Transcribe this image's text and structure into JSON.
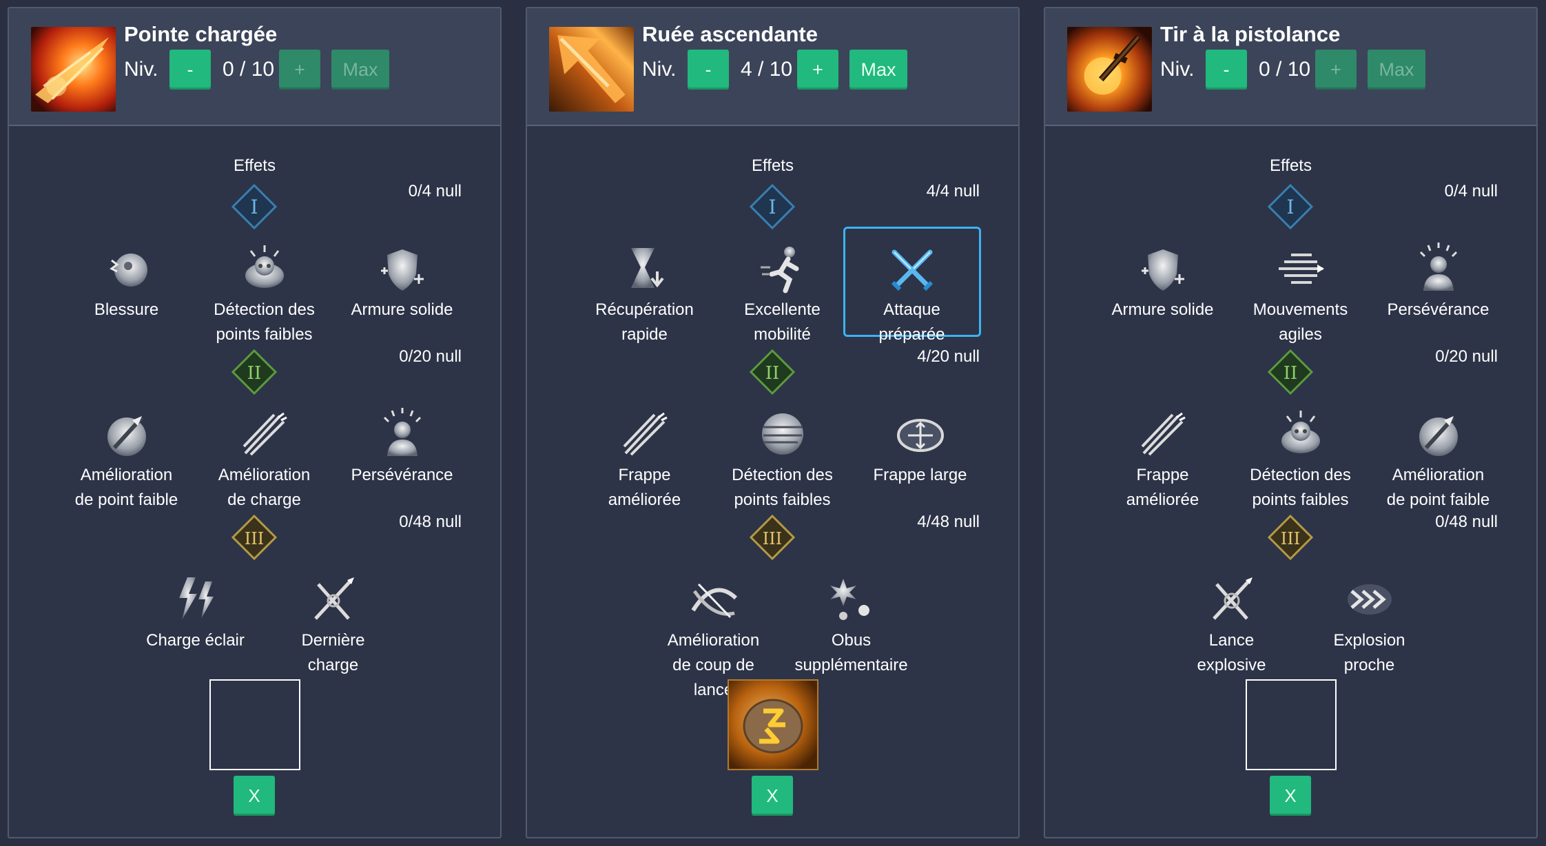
{
  "panels": [
    {
      "name": "Pointe chargée",
      "level_label": "Niv.",
      "level": "0 / 10",
      "minus": "-",
      "plus": "+",
      "max": "Max",
      "effects_title": "Effets",
      "tiers": [
        {
          "numeral": "I",
          "count": "0/4 null",
          "tripods": [
            {
              "label": "Blessure",
              "icon": "wound-icon"
            },
            {
              "label": "Détection des points faibles",
              "icon": "weak-point-detection-icon"
            },
            {
              "label": "Armure solide",
              "icon": "solid-armor-icon"
            }
          ]
        },
        {
          "numeral": "II",
          "count": "0/20 null",
          "tripods": [
            {
              "label": "Amélioration de point faible",
              "icon": "weak-point-enhancement-icon"
            },
            {
              "label": "Amélioration de charge",
              "icon": "charge-enhancement-icon"
            },
            {
              "label": "Persévérance",
              "icon": "perseverance-icon"
            }
          ]
        },
        {
          "numeral": "III",
          "count": "0/48 null",
          "tripods": [
            {
              "label": "Charge éclair",
              "icon": "lightning-charge-icon"
            },
            {
              "label": "Dernière charge",
              "icon": "last-charge-icon"
            }
          ]
        }
      ],
      "rune": "empty",
      "close": "X"
    },
    {
      "name": "Ruée ascendante",
      "level_label": "Niv.",
      "level": "4 / 10",
      "minus": "-",
      "plus": "+",
      "max": "Max",
      "effects_title": "Effets",
      "tiers": [
        {
          "numeral": "I",
          "count": "4/4 null",
          "tripods": [
            {
              "label": "Récupération rapide",
              "icon": "hourglass-icon"
            },
            {
              "label": "Excellente mobilité",
              "icon": "running-icon"
            },
            {
              "label": "Attaque préparée",
              "icon": "crossed-swords-icon",
              "selected": true
            }
          ]
        },
        {
          "numeral": "II",
          "count": "4/20 null",
          "tripods": [
            {
              "label": "Frappe améliorée",
              "icon": "enhanced-strike-icon"
            },
            {
              "label": "Détection des points faibles",
              "icon": "weak-point-detection-icon"
            },
            {
              "label": "Frappe large",
              "icon": "wide-strike-icon"
            }
          ]
        },
        {
          "numeral": "III",
          "count": "4/48 null",
          "tripods": [
            {
              "label": "Amélioration de coup de lance",
              "icon": "lance-strike-icon"
            },
            {
              "label": "Obus supplémentaire",
              "icon": "extra-shell-icon"
            }
          ]
        }
      ],
      "rune": "filled",
      "rune_icon": "rune-icon",
      "close": "X"
    },
    {
      "name": "Tir à la pistolance",
      "level_label": "Niv.",
      "level": "0 / 10",
      "minus": "-",
      "plus": "+",
      "max": "Max",
      "effects_title": "Effets",
      "tiers": [
        {
          "numeral": "I",
          "count": "0/4 null",
          "tripods": [
            {
              "label": "Armure solide",
              "icon": "solid-armor-icon"
            },
            {
              "label": "Mouvements agiles",
              "icon": "agile-movement-icon"
            },
            {
              "label": "Persévérance",
              "icon": "perseverance-icon"
            }
          ]
        },
        {
          "numeral": "II",
          "count": "0/20 null",
          "tripods": [
            {
              "label": "Frappe améliorée",
              "icon": "enhanced-strike-icon"
            },
            {
              "label": "Détection des points faibles",
              "icon": "weak-point-detection-icon"
            },
            {
              "label": "Amélioration de point faible",
              "icon": "weak-point-enhancement-icon"
            }
          ]
        },
        {
          "numeral": "III",
          "count": "0/48 null",
          "tripods": [
            {
              "label": "Lance explosive",
              "icon": "explosive-lance-icon"
            },
            {
              "label": "Explosion proche",
              "icon": "close-explosion-icon"
            }
          ]
        }
      ],
      "rune": "empty",
      "close": "X"
    }
  ],
  "colors": {
    "background": "#2a3042",
    "header": "#3c4459",
    "button": "#21b97d",
    "button_dim": "#2e8a69",
    "selected_border": "#3cb3f3",
    "tier1": "#3a7fb0",
    "tier2": "#5c9a3e",
    "tier3": "#b59a45"
  }
}
